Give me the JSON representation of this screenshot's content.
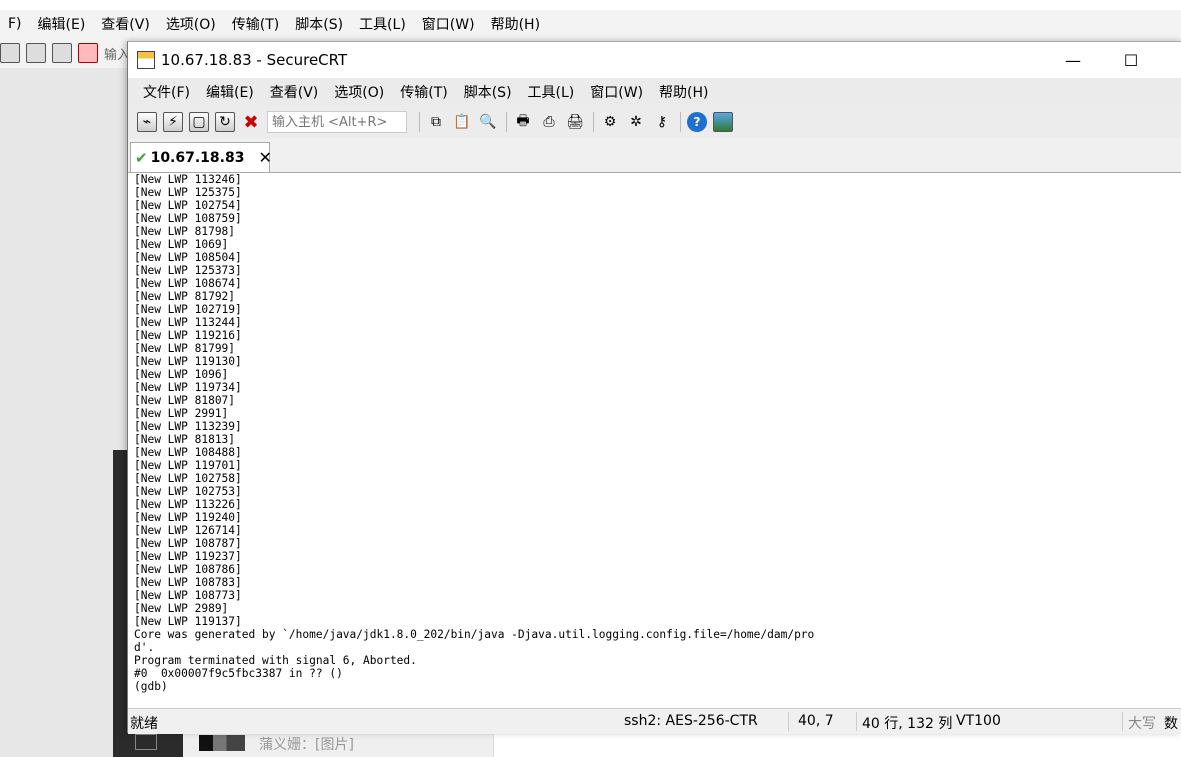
{
  "background_app": {
    "menu": [
      "F)",
      "编辑(E)",
      "查看(V)",
      "选项(O)",
      "传输(T)",
      "脚本(S)",
      "工具(L)",
      "窗口(W)",
      "帮助(H)"
    ],
    "toolbar_input_partial": "输入",
    "chat_preview": "蒲义姗：[图片]"
  },
  "window": {
    "title": "10.67.18.83 - SecureCRT",
    "minimize": "—",
    "maximize": "☐"
  },
  "menu": [
    "文件(F)",
    "编辑(E)",
    "查看(V)",
    "选项(O)",
    "传输(T)",
    "脚本(S)",
    "工具(L)",
    "窗口(W)",
    "帮助(H)"
  ],
  "toolbar": {
    "host_input_placeholder": "输入主机 <Alt+R>",
    "icons": [
      "connect-icon",
      "quick-connect-icon",
      "connect-tab-icon",
      "reconnect-icon",
      "disconnect-icon",
      "copy-icon",
      "paste-icon",
      "find-icon",
      "print-icon",
      "print-selection-icon",
      "printer-icon",
      "session-options-icon",
      "global-options-icon",
      "keymap-icon",
      "help-icon",
      "screen-icon"
    ]
  },
  "tab": {
    "label": "10.67.18.83",
    "close": "✕"
  },
  "terminal": {
    "lines": [
      "[New LWP 113246]",
      "[New LWP 125375]",
      "[New LWP 102754]",
      "[New LWP 108759]",
      "[New LWP 81798]",
      "[New LWP 1069]",
      "[New LWP 108504]",
      "[New LWP 125373]",
      "[New LWP 108674]",
      "[New LWP 81792]",
      "[New LWP 102719]",
      "[New LWP 113244]",
      "[New LWP 119216]",
      "[New LWP 81799]",
      "[New LWP 119130]",
      "[New LWP 1096]",
      "[New LWP 119734]",
      "[New LWP 81807]",
      "[New LWP 2991]",
      "[New LWP 113239]",
      "[New LWP 81813]",
      "[New LWP 108488]",
      "[New LWP 119701]",
      "[New LWP 102758]",
      "[New LWP 102753]",
      "[New LWP 113226]",
      "[New LWP 119240]",
      "[New LWP 126714]",
      "[New LWP 108787]",
      "[New LWP 119237]",
      "[New LWP 108786]",
      "[New LWP 108783]",
      "[New LWP 108773]",
      "[New LWP 2989]",
      "[New LWP 119137]",
      "Core was generated by `/home/java/jdk1.8.0_202/bin/java -Djava.util.logging.config.file=/home/dam/pro",
      "d'.",
      "Program terminated with signal 6, Aborted.",
      "#0  0x00007f9c5fbc3387 in ?? ()",
      "(gdb)"
    ]
  },
  "status": {
    "ready": "就绪",
    "cipher": "ssh2: AES-256-CTR",
    "cursor": "40,  7",
    "size": "40 行, 132 列",
    "term": "VT100",
    "caps": "大写",
    "num": "数"
  },
  "colors": {
    "terminal_bg": "#ffffff",
    "terminal_fg": "#000000",
    "tab_check": "#3aa33a",
    "disconnect_icon": "#cc0000"
  }
}
